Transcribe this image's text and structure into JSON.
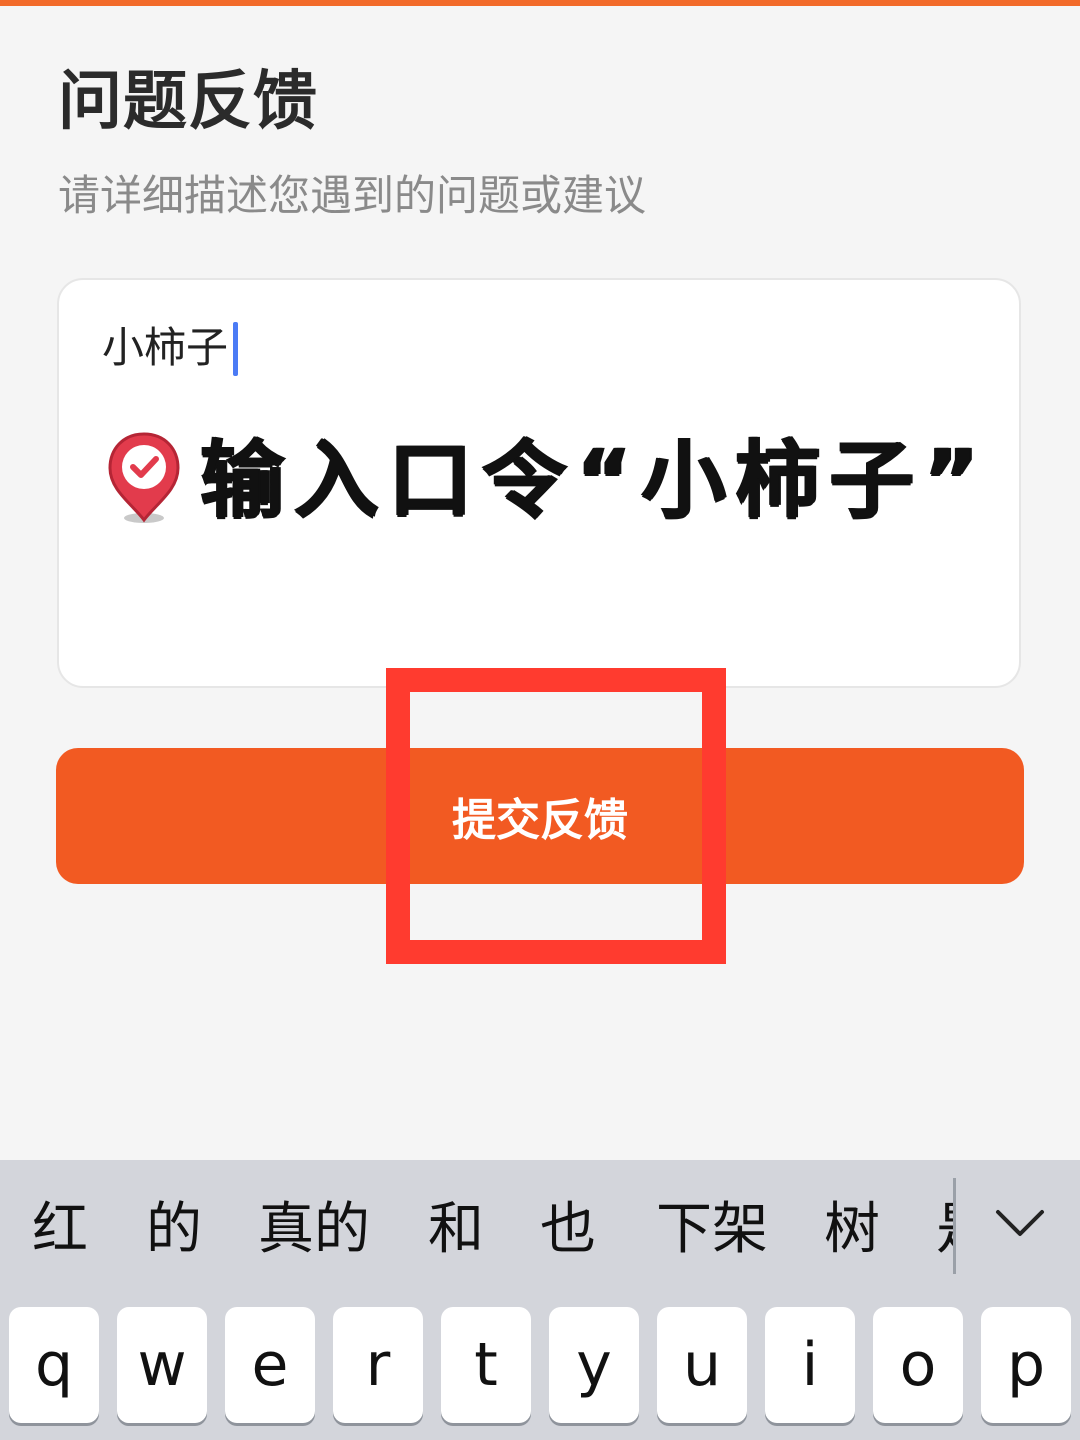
{
  "header": {
    "title": "问题反馈",
    "subtitle": "请详细描述您遇到的问题或建议"
  },
  "feedback": {
    "input_value": "小柿子",
    "overlay_caption": "输入口令“小柿子”"
  },
  "submit": {
    "label": "提交反馈"
  },
  "keyboard": {
    "candidates": [
      "红",
      "的",
      "真的",
      "和",
      "也",
      "下架",
      "树",
      "是"
    ],
    "keys": [
      "q",
      "w",
      "e",
      "r",
      "t",
      "y",
      "u",
      "i",
      "o",
      "p"
    ]
  },
  "colors": {
    "accent": "#f25a22",
    "highlight": "#ff3b2f",
    "caret": "#4b7bf5"
  },
  "icons": {
    "pin": "location-pin-check-icon",
    "collapse": "chevron-down-icon"
  }
}
